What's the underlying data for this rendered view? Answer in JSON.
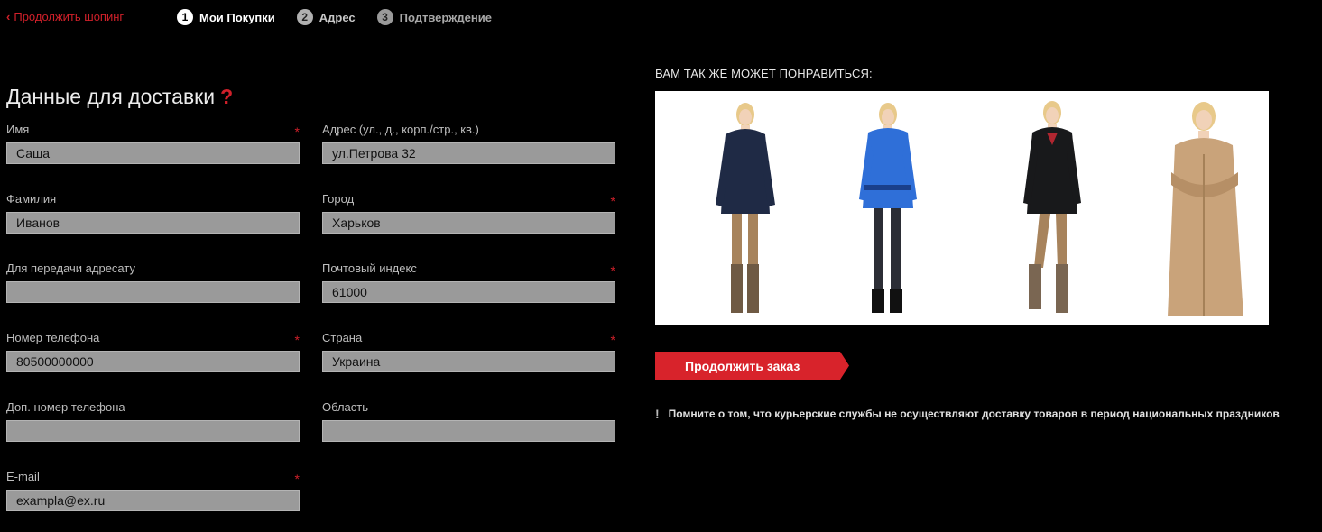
{
  "nav": {
    "back_label": "Продолжить шопинг",
    "steps": [
      {
        "num": "1",
        "label": "Мои Покупки"
      },
      {
        "num": "2",
        "label": "Адрес"
      },
      {
        "num": "3",
        "label": "Подтверждение"
      }
    ]
  },
  "form": {
    "title": "Данные для доставки",
    "help_mark": "?",
    "fields": {
      "first_name": {
        "label": "Имя",
        "value": "Саша",
        "required": "*"
      },
      "last_name": {
        "label": "Фамилия",
        "value": "Иванов"
      },
      "recipient_note": {
        "label": "Для передачи адресату",
        "value": ""
      },
      "phone": {
        "label": "Номер телефона",
        "value": "80500000000",
        "required": "*"
      },
      "phone_extra": {
        "label": "Доп. номер телефона",
        "value": ""
      },
      "email": {
        "label": "E-mail",
        "value": "exampla@ex.ru",
        "required": "*"
      },
      "address": {
        "label": "Адрес (ул., д., корп./стр., кв.)",
        "value": "ул.Петрова 32"
      },
      "city": {
        "label": "Город",
        "value": "Харьков",
        "required": "*"
      },
      "postal_code": {
        "label": "Почтовый индекс",
        "value": "61000",
        "required": "*"
      },
      "country": {
        "label": "Страна",
        "value": "Украина",
        "required": "*"
      },
      "region": {
        "label": "Область",
        "value": ""
      }
    }
  },
  "recommend": {
    "title": "ВАМ ТАК ЖЕ МОЖЕТ ПОНРАВИТЬСЯ:"
  },
  "actions": {
    "continue_label": "Продолжить заказ"
  },
  "notice": {
    "icon": "!",
    "text": "Помните о том, что курьерские службы не осуществляют доставку товаров в период национальных праздников"
  },
  "colors": {
    "accent": "#d8232b",
    "background": "#000000",
    "input_bg": "#9a9a9a"
  }
}
